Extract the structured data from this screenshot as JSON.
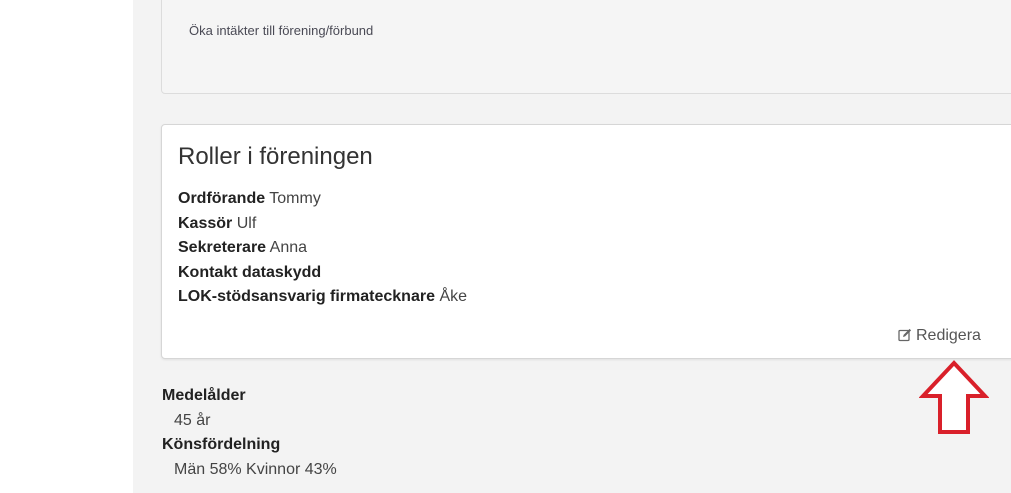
{
  "goal_panel": {
    "text": "Öka intäkter till förening/förbund"
  },
  "roles_panel": {
    "title": "Roller i föreningen",
    "roles": [
      {
        "role": "Ordförande",
        "person": "Tommy"
      },
      {
        "role": "Kassör",
        "person": "Ulf"
      },
      {
        "role": "Sekreterare",
        "person": "Anna"
      },
      {
        "role": "Kontakt dataskydd",
        "person": ""
      },
      {
        "role": "LOK-stödsansvarig firmatecknare",
        "person": "Åke"
      }
    ],
    "edit_label": "Redigera",
    "edit_icon": "edit-icon"
  },
  "stats": {
    "age_label": "Medelålder",
    "age_value": "45 år",
    "gender_label": "Könsfördelning",
    "gender_value": "Män 58% Kvinnor 43%"
  },
  "annotation": {
    "arrow_icon": "arrow-up-outline-icon",
    "arrow_color": "#d9202a"
  }
}
